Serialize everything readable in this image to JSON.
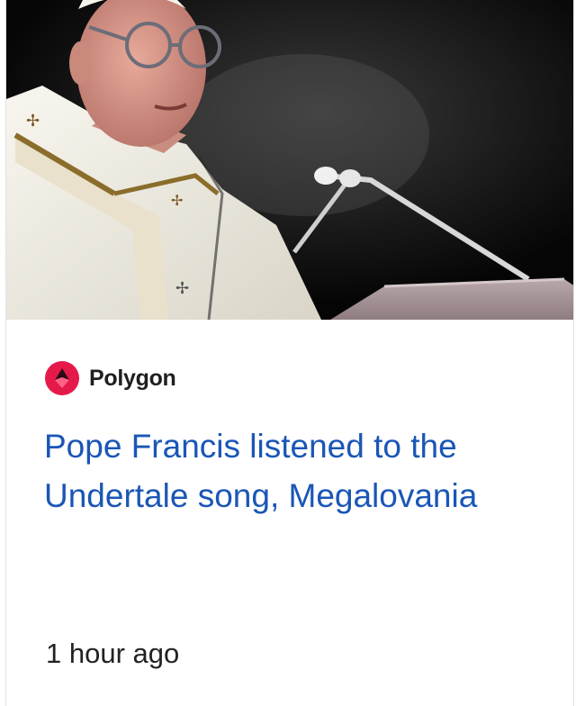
{
  "article": {
    "source_name": "Polygon",
    "source_icon": "polygon-logo-icon",
    "headline": "Pope Francis listened to the Undertale song, Megalovania",
    "timestamp": "1 hour ago",
    "image_subject": "pope-at-lectern-photo"
  },
  "colors": {
    "headline": "#1a56b6",
    "source_logo": "#e6194b",
    "source_text": "#1f1f1f",
    "timestamp": "#222222"
  }
}
